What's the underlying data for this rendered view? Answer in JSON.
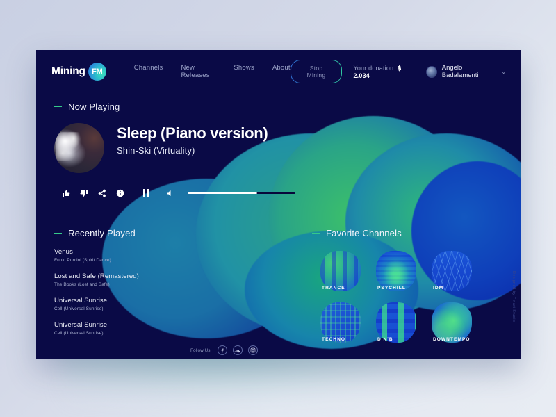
{
  "header": {
    "logo_text": "Mining",
    "logo_badge": "FM",
    "nav": [
      {
        "label": "Channels"
      },
      {
        "label": "New Releases"
      },
      {
        "label": "Shows"
      },
      {
        "label": "About"
      }
    ],
    "mine_button": "Stop Mining",
    "donation_label": "Your donation:",
    "donation_value": "฿ 2.034",
    "user_name": "Angelo Badalamenti",
    "chevron": "⌄"
  },
  "now_playing": {
    "section_title": "Now Playing",
    "track_title": "Sleep (Piano version)",
    "track_artist": "Shin-Ski (Virtuality)",
    "controls": {
      "thumbs_up": "thumbs-up-icon",
      "thumbs_down": "thumbs-down-icon",
      "share": "share-icon",
      "info": "info-icon",
      "pause": "pause-icon",
      "volume": "volume-icon",
      "volume_percent": "65"
    }
  },
  "recently_played": {
    "section_title": "Recently Played",
    "items": [
      {
        "title": "Venus",
        "subtitle": "Funki Porcini (Spirit Dance)"
      },
      {
        "title": "Lost and Safe (Remastered)",
        "subtitle": "The Books (Lost and Safe)"
      },
      {
        "title": "Universal Sunrise",
        "subtitle": "Cell (Universal Sunrise)"
      },
      {
        "title": "Universal Sunrise",
        "subtitle": "Cell (Universal Sunrise)"
      }
    ]
  },
  "follow": {
    "label": "Follow Us",
    "networks": [
      {
        "name": "facebook-icon"
      },
      {
        "name": "soundcloud-icon"
      },
      {
        "name": "instagram-icon"
      }
    ]
  },
  "favorite_channels": {
    "section_title": "Favorite Channels",
    "items": [
      {
        "label": "TRANCE"
      },
      {
        "label": "PSYCHILL"
      },
      {
        "label": "IDM"
      },
      {
        "label": "TECHNO"
      },
      {
        "label": "D'N'B"
      },
      {
        "label": "DOWNTEMPO"
      }
    ]
  },
  "credit": "Designed by Finart Studio",
  "colors": {
    "card_bg": "#0a0a46",
    "page_bg": "#ccd2e4",
    "accent_green": "#35c98a",
    "accent_blue": "#1a56d8",
    "text_primary": "#ffffff",
    "text_muted": "#9aa2c8"
  }
}
